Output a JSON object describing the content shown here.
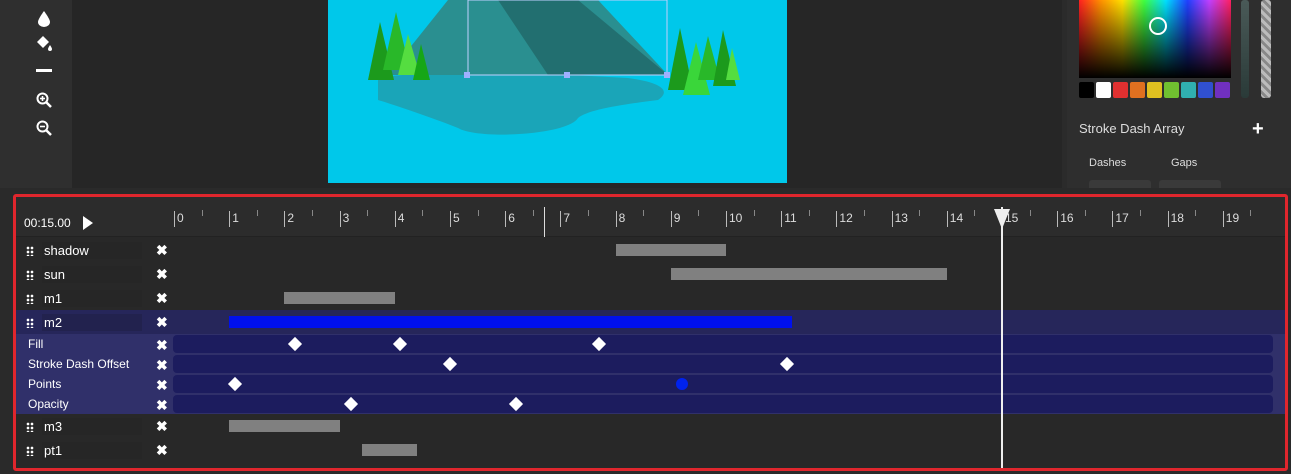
{
  "toolbar": {
    "tools": [
      {
        "icon": "drop-icon",
        "glyph": "💧"
      },
      {
        "icon": "paint-bucket-icon",
        "glyph": "⛽"
      },
      {
        "icon": "minus-icon",
        "glyph": "—"
      },
      {
        "icon": "zoom-in-icon",
        "glyph": "⊕"
      },
      {
        "icon": "zoom-out-icon",
        "glyph": "⊖"
      }
    ]
  },
  "right_panel": {
    "swatch_colors": [
      "#000000",
      "#ffffff",
      "#e03030",
      "#e07020",
      "#e0c020",
      "#70c030",
      "#30b0b0",
      "#3050d0",
      "#7030c0"
    ],
    "stroke_dash_array_label": "Stroke Dash Array",
    "add_label": "+",
    "dashes_label": "Dashes",
    "gaps_label": "Gaps"
  },
  "timeline": {
    "current_time": "00:15.00",
    "ruler_labels": [
      "0",
      "1",
      "2",
      "3",
      "4",
      "5",
      "6",
      "7",
      "8",
      "9",
      "10",
      "11",
      "12",
      "13",
      "14",
      "15",
      "16",
      "17",
      "18",
      "19"
    ],
    "playhead_time": 15,
    "layers": [
      {
        "name": "shadow",
        "start": 8,
        "end": 10,
        "color": "#808080",
        "selected": false
      },
      {
        "name": "sun",
        "start": 9,
        "end": 14,
        "color": "#808080",
        "selected": false
      },
      {
        "name": "m1",
        "start": 2,
        "end": 4,
        "color": "#808080",
        "selected": false
      },
      {
        "name": "m2",
        "start": 1,
        "end": 11.2,
        "color": "#0010ee",
        "selected": true,
        "properties": [
          {
            "name": "Fill",
            "keyframes": [
              2.2,
              4.1,
              7.7
            ]
          },
          {
            "name": "Stroke Dash Offset",
            "keyframes": [
              5,
              11.1
            ]
          },
          {
            "name": "Points",
            "keyframes": [
              1.1
            ],
            "active_keyframes": [
              9.2
            ]
          },
          {
            "name": "Opacity",
            "keyframes": [
              3.2,
              6.2
            ]
          }
        ]
      },
      {
        "name": "m3",
        "start": 1,
        "end": 3,
        "color": "#808080",
        "selected": false
      },
      {
        "name": "pt1",
        "start": 3.4,
        "end": 4.4,
        "color": "#808080",
        "selected": false
      }
    ],
    "close_glyph": "✖"
  }
}
